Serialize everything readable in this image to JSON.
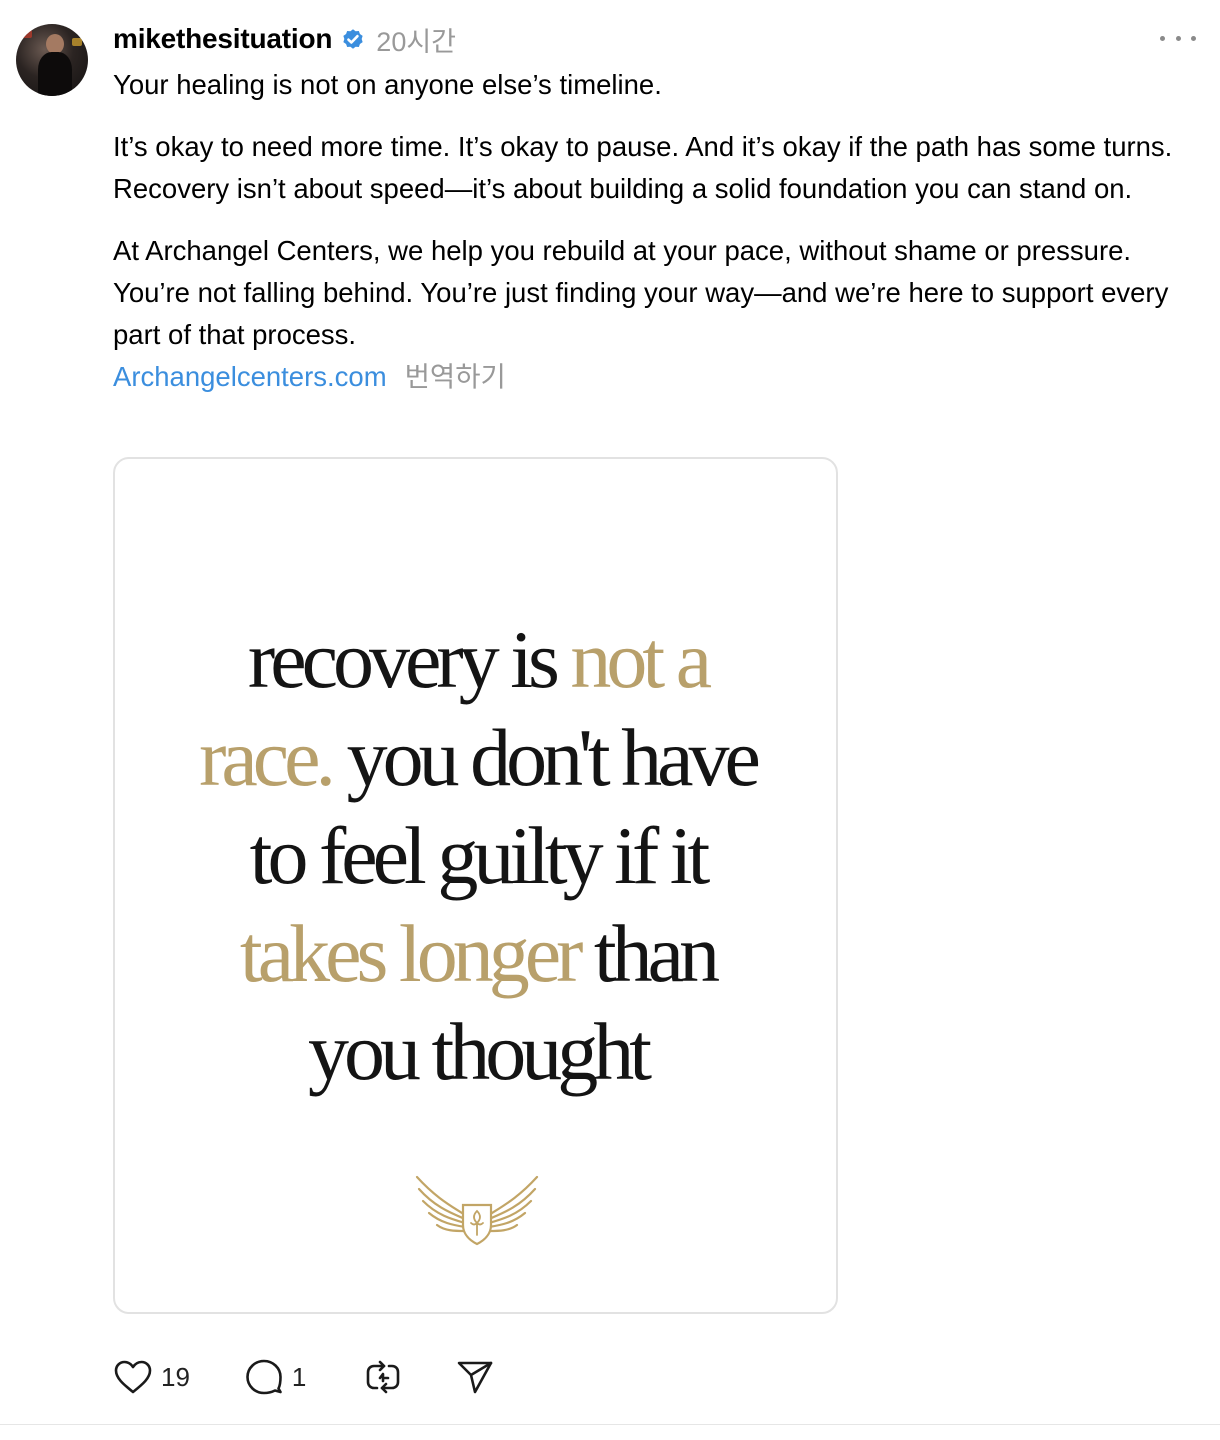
{
  "post": {
    "username": "mikethesituation",
    "verified": true,
    "time": "20시간",
    "caption": {
      "line1": "Your healing is not on anyone else’s timeline.",
      "para2": "It’s okay to need more time. It’s okay to pause. And it’s okay if the path has some turns. Recovery isn’t about speed—it’s about building a solid foundation you can stand on.",
      "para3": "At Archangel Centers, we help you rebuild at your pace, without shame or pressure. You’re not falling behind. You’re just finding your way—and we’re here to support every part of that process.",
      "link": "Archangelcenters.com",
      "translate": "번역하기"
    },
    "image": {
      "quote_segments": [
        {
          "text": "recovery is ",
          "accent": false
        },
        {
          "text": "not a",
          "accent": true
        },
        {
          "text": " ",
          "accent": false
        },
        {
          "text": "race.",
          "accent": true
        },
        {
          "text": " you don't have to feel guilty if it ",
          "accent": false
        },
        {
          "text": "takes longer",
          "accent": true
        },
        {
          "text": " than you thought",
          "accent": false
        }
      ],
      "logo_icon": "winged-shield-fleur-de-lis-icon"
    },
    "actions": {
      "likes": "19",
      "replies": "1"
    }
  },
  "colors": {
    "link": "#3b8ede",
    "muted": "#999999",
    "accent_gold": "#b8a06b",
    "verified_badge": "#3b8ede",
    "quote_text": "#141414"
  }
}
